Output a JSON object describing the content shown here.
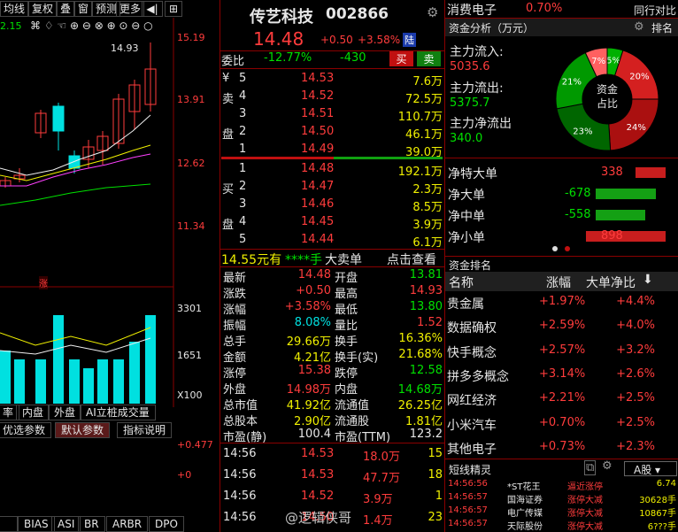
{
  "toolbar": {
    "items": [
      "均线",
      "复权",
      "叠",
      "窗",
      "预测",
      "更多"
    ]
  },
  "chart": {
    "legend_value": "2.15",
    "tips": [
      "14.93"
    ],
    "price_axis": [
      "15.19",
      "13.91",
      "12.62",
      "11.34"
    ],
    "vol_axis": [
      "3301",
      "1651",
      "X100"
    ],
    "sub_axis": [
      "+0.477",
      "+0"
    ],
    "zhang": "涨",
    "bottom_tabs": [
      "率",
      "内盘",
      "外盘",
      "AI立桩成交量"
    ],
    "param_tabs": [
      "优选参数",
      "默认参数",
      "指标说明"
    ],
    "indicator_tabs": [
      "",
      "BIAS",
      "ASI",
      "BR",
      "ARBR",
      "DPO"
    ]
  },
  "stock": {
    "name": "传艺科技",
    "code": "002866",
    "price": "14.48",
    "change": "+0.50",
    "pct": "+3.58%",
    "market": "陆"
  },
  "weibi": {
    "label": "委比",
    "ratio": "-12.77%",
    "diff": "-430",
    "buy_btn": "买",
    "sell_btn": "卖"
  },
  "orderbook": {
    "sell_label": [
      "¥",
      "卖",
      "",
      "盘",
      ""
    ],
    "asks": [
      {
        "lv": "5",
        "p": "14.53",
        "v": "7.6万"
      },
      {
        "lv": "4",
        "p": "14.52",
        "v": "72.5万"
      },
      {
        "lv": "3",
        "p": "14.51",
        "v": "110.7万"
      },
      {
        "lv": "2",
        "p": "14.50",
        "v": "46.1万"
      },
      {
        "lv": "1",
        "p": "14.49",
        "v": "39.0万"
      }
    ],
    "bids": [
      {
        "lv": "1",
        "p": "14.48",
        "v": "192.1万"
      },
      {
        "lv": "2",
        "p": "14.47",
        "v": "2.3万"
      },
      {
        "lv": "3",
        "p": "14.46",
        "v": "8.5万"
      },
      {
        "lv": "4",
        "p": "14.45",
        "v": "3.9万"
      },
      {
        "lv": "5",
        "p": "14.44",
        "v": "6.1万"
      }
    ],
    "buy_label": [
      "买",
      "盘"
    ]
  },
  "bigorder": {
    "text1": "14.55元有",
    "text2": "****手",
    "text3": "大卖单",
    "text4": "点击查看"
  },
  "quotes": [
    {
      "l": "最新",
      "v": "14.48",
      "l2": "开盘",
      "v2": "13.81"
    },
    {
      "l": "涨跌",
      "v": "+0.50",
      "l2": "最高",
      "v2": "14.93"
    },
    {
      "l": "涨幅",
      "v": "+3.58%",
      "l2": "最低",
      "v2": "13.80"
    },
    {
      "l": "振幅",
      "v": "8.08%",
      "l2": "量比",
      "v2": "1.52"
    },
    {
      "l": "总手",
      "v": "29.66万",
      "l2": "换手",
      "v2": "16.36%"
    },
    {
      "l": "金额",
      "v": "4.21亿",
      "l2": "换手(实)",
      "v2": "21.68%"
    },
    {
      "l": "涨停",
      "v": "15.38",
      "l2": "跌停",
      "v2": "12.58"
    },
    {
      "l": "外盘",
      "v": "14.98万",
      "l2": "内盘",
      "v2": "14.68万"
    },
    {
      "l": "总市值",
      "v": "41.92亿",
      "l2": "流通值",
      "v2": "26.25亿"
    },
    {
      "l": "总股本",
      "v": "2.90亿",
      "l2": "流通股",
      "v2": "1.81亿"
    },
    {
      "l": "市盈(静)",
      "v": "100.4",
      "l2": "市盈(TTM)",
      "v2": "123.2"
    }
  ],
  "ticks": [
    {
      "t": "14:56",
      "p": "14.53",
      "v": "18.0万",
      "n": "15"
    },
    {
      "t": "14:56",
      "p": "14.53",
      "v": "47.7万",
      "n": "18"
    },
    {
      "t": "14:56",
      "p": "14.52",
      "v": "3.9万",
      "n": "1"
    },
    {
      "t": "14:56",
      "p": "14.50",
      "v": "1.4万",
      "n": "23"
    }
  ],
  "sector": {
    "name": "消费电子",
    "pct": "0.70%",
    "label": "同行对比"
  },
  "funds": {
    "title": "资金分析（万元）",
    "rank_label": "排名",
    "inflow_label": "主力流入:",
    "inflow": "5035.6",
    "outflow_label": "主力流出:",
    "outflow": "5375.7",
    "net_label": "主力净流出",
    "net": "340.0",
    "donut_center": [
      "资金",
      "占比"
    ],
    "slices": [
      {
        "label": "5%",
        "value": 5,
        "color": "#00b000"
      },
      {
        "label": "20%",
        "value": 20,
        "color": "#d42020"
      },
      {
        "label": "24%",
        "value": 24,
        "color": "#aa1010"
      },
      {
        "label": "23%",
        "value": 23,
        "color": "#006600"
      },
      {
        "label": "21%",
        "value": 21,
        "color": "#009900"
      },
      {
        "label": "7%",
        "value": 7,
        "color": "#ff6060"
      }
    ]
  },
  "flows": [
    {
      "l": "净特大单",
      "v": "338",
      "n": 338
    },
    {
      "l": "净大单",
      "v": "-678",
      "n": -678
    },
    {
      "l": "净中单",
      "v": "-558",
      "n": -558
    },
    {
      "l": "净小单",
      "v": "898",
      "n": 898
    }
  ],
  "ranking": {
    "title": "资金排名",
    "cols": [
      "名称",
      "涨幅",
      "大单净比"
    ],
    "rows": [
      {
        "n": "贵金属",
        "a": "+1.97%",
        "b": "+4.4%"
      },
      {
        "n": "数据确权",
        "a": "+2.59%",
        "b": "+4.0%"
      },
      {
        "n": "快手概念",
        "a": "+2.57%",
        "b": "+3.2%"
      },
      {
        "n": "拼多多概念",
        "a": "+3.14%",
        "b": "+2.6%"
      },
      {
        "n": "网红经济",
        "a": "+2.21%",
        "b": "+2.5%"
      },
      {
        "n": "小米汽车",
        "a": "+0.70%",
        "b": "+2.5%"
      },
      {
        "n": "其他电子",
        "a": "+0.73%",
        "b": "+2.3%"
      }
    ]
  },
  "short": {
    "title": "短线精灵",
    "market": "A股",
    "rows": [
      {
        "t": "14:56:56",
        "n": "*ST花王",
        "e": "逼近涨停",
        "v": "6.74"
      },
      {
        "t": "14:56:57",
        "n": "国海证券",
        "e": "涨停大减",
        "v": "30628手"
      },
      {
        "t": "14:56:57",
        "n": "电广传媒",
        "e": "涨停大减",
        "v": "10867手"
      },
      {
        "t": "14:56:57",
        "n": "天际股份",
        "e": "涨停大减",
        "v": "6???手"
      }
    ]
  },
  "watermark": "@逻辑侠哥"
}
